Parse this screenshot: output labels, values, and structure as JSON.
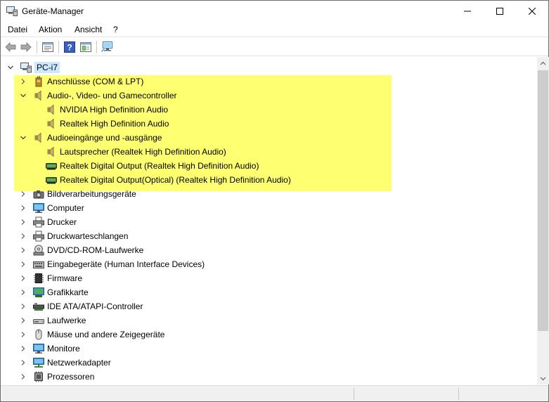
{
  "window": {
    "title": "Geräte-Manager"
  },
  "menu": [
    "Datei",
    "Aktion",
    "Ansicht",
    "?"
  ],
  "toolbar": {
    "buttons": [
      "back-arrow-icon",
      "forward-arrow-icon",
      "properties-icon",
      "help-icon",
      "view-icon",
      "monitor-scan-icon"
    ]
  },
  "tree": {
    "root": "PC-i7",
    "nodes": [
      {
        "label": "Anschlüsse (COM & LPT)",
        "icon": "port-icon",
        "expanded": false,
        "level": 1
      },
      {
        "label": "Audio-, Video- und Gamecontroller",
        "icon": "speaker-icon",
        "expanded": true,
        "level": 1
      },
      {
        "label": "NVIDIA High Definition Audio",
        "icon": "speaker-icon",
        "level": 2
      },
      {
        "label": "Realtek High Definition Audio",
        "icon": "speaker-icon",
        "level": 2
      },
      {
        "label": "Audioeingänge und -ausgänge",
        "icon": "speaker-icon",
        "expanded": true,
        "level": 1
      },
      {
        "label": "Lautsprecher (Realtek High Definition Audio)",
        "icon": "speaker-icon",
        "level": 2
      },
      {
        "label": "Realtek Digital Output (Realtek High Definition Audio)",
        "icon": "digital-output-icon",
        "level": 2
      },
      {
        "label": "Realtek Digital Output(Optical) (Realtek High Definition Audio)",
        "icon": "digital-output-icon",
        "level": 2
      },
      {
        "label": "Bildverarbeitungsgeräte",
        "icon": "camera-icon",
        "expanded": false,
        "level": 1
      },
      {
        "label": "Computer",
        "icon": "computer-icon",
        "expanded": false,
        "level": 1
      },
      {
        "label": "Drucker",
        "icon": "printer-icon",
        "expanded": false,
        "level": 1
      },
      {
        "label": "Druckwarteschlangen",
        "icon": "printer-icon",
        "expanded": false,
        "level": 1
      },
      {
        "label": "DVD/CD-ROM-Laufwerke",
        "icon": "dvd-drive-icon",
        "expanded": false,
        "level": 1
      },
      {
        "label": "Eingabegeräte (Human Interface Devices)",
        "icon": "keyboard-icon",
        "expanded": false,
        "level": 1
      },
      {
        "label": "Firmware",
        "icon": "chip-icon",
        "expanded": false,
        "level": 1
      },
      {
        "label": "Grafikkarte",
        "icon": "display-adapter-icon",
        "expanded": false,
        "level": 1
      },
      {
        "label": "IDE ATA/ATAPI-Controller",
        "icon": "ide-controller-icon",
        "expanded": false,
        "level": 1
      },
      {
        "label": "Laufwerke",
        "icon": "disk-drive-icon",
        "expanded": false,
        "level": 1
      },
      {
        "label": "Mäuse und andere Zeigegeräte",
        "icon": "mouse-icon",
        "expanded": false,
        "level": 1
      },
      {
        "label": "Monitore",
        "icon": "monitor-icon",
        "expanded": false,
        "level": 1
      },
      {
        "label": "Netzwerkadapter",
        "icon": "network-adapter-icon",
        "expanded": false,
        "level": 1
      },
      {
        "label": "Prozessoren",
        "icon": "processor-icon",
        "expanded": false,
        "level": 1
      }
    ]
  },
  "colors": {
    "highlight": "#ffff66",
    "selection": "#cce8ff"
  }
}
